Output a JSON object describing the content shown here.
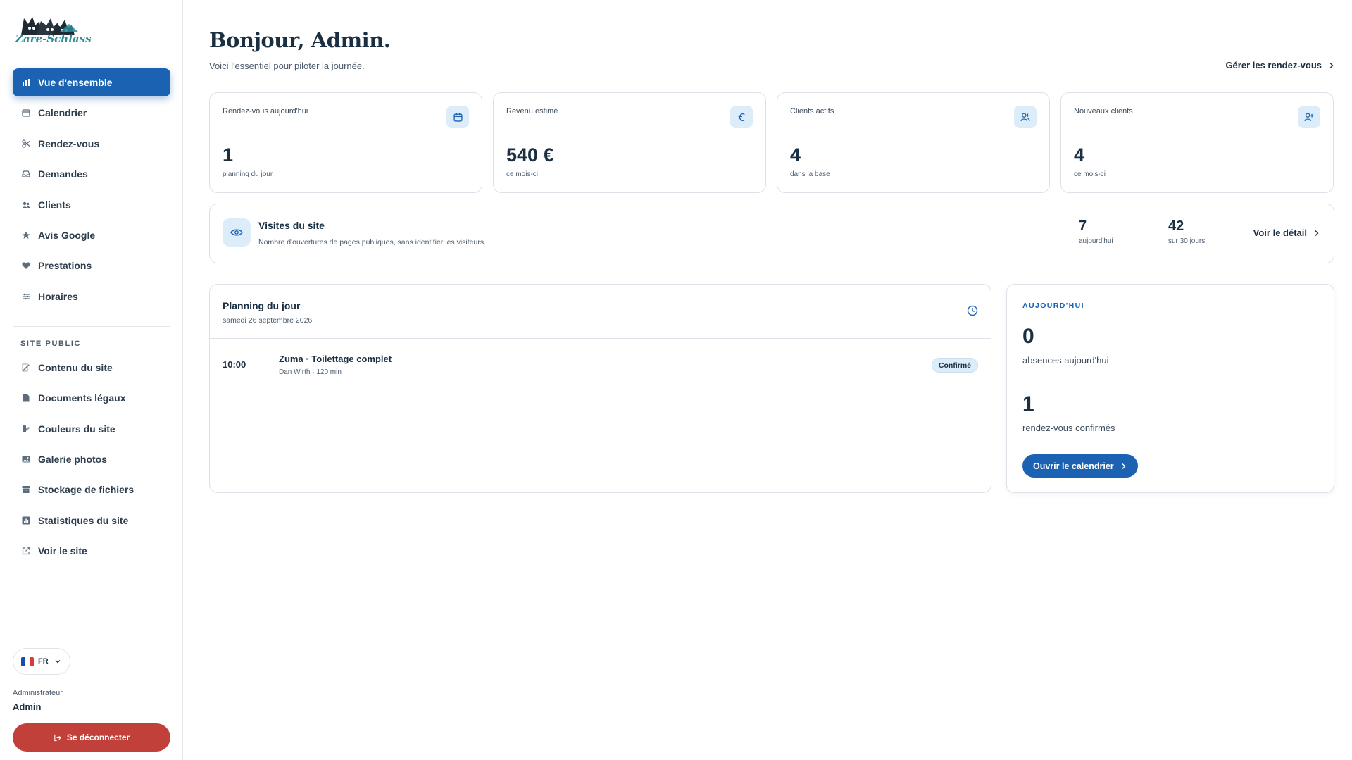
{
  "brand": {
    "logo_text": "Zare-Schlass"
  },
  "sidebar": {
    "items": [
      {
        "label": "Vue d'ensemble",
        "icon": "bar-chart-icon",
        "active": true
      },
      {
        "label": "Calendrier",
        "icon": "calendar-icon"
      },
      {
        "label": "Rendez-vous",
        "icon": "scissors-icon"
      },
      {
        "label": "Demandes",
        "icon": "inbox-icon"
      },
      {
        "label": "Clients",
        "icon": "users-icon"
      },
      {
        "label": "Avis Google",
        "icon": "star-icon"
      },
      {
        "label": "Prestations",
        "icon": "heart-icon"
      },
      {
        "label": "Horaires",
        "icon": "sliders-icon"
      }
    ],
    "section_label": "SITE PUBLIC",
    "site_items": [
      {
        "label": "Contenu du site",
        "icon": "edit-icon"
      },
      {
        "label": "Documents légaux",
        "icon": "document-icon"
      },
      {
        "label": "Couleurs du site",
        "icon": "palette-icon"
      },
      {
        "label": "Galerie photos",
        "icon": "image-icon"
      },
      {
        "label": "Stockage de fichiers",
        "icon": "archive-icon"
      },
      {
        "label": "Statistiques du site",
        "icon": "stats-icon"
      }
    ],
    "view_site": {
      "label": "Voir le site",
      "icon": "external-link-icon"
    },
    "language": "FR",
    "role": "Administrateur",
    "user": "Admin",
    "logout_label": "Se déconnecter"
  },
  "header": {
    "greeting": "Bonjour, Admin.",
    "subtitle": "Voici l'essentiel pour piloter la journée.",
    "manage_link": "Gérer les rendez-vous"
  },
  "stats": [
    {
      "label": "Rendez-vous aujourd'hui",
      "value": "1",
      "caption": "planning du jour",
      "icon": "calendar-icon"
    },
    {
      "label": "Revenu estimé",
      "value": "540 €",
      "caption": "ce mois-ci",
      "icon": "euro-icon"
    },
    {
      "label": "Clients actifs",
      "value": "4",
      "caption": "dans la base",
      "icon": "users-icon"
    },
    {
      "label": "Nouveaux clients",
      "value": "4",
      "caption": "ce mois-ci",
      "icon": "user-plus-icon"
    }
  ],
  "visits": {
    "title": "Visites du site",
    "description": "Nombre d'ouvertures de pages publiques, sans identifier les visiteurs.",
    "today_value": "7",
    "today_caption": "aujourd'hui",
    "month_value": "42",
    "month_caption": "sur 30 jours",
    "link": "Voir le détail"
  },
  "planning": {
    "title": "Planning du jour",
    "date": "samedi 26 septembre 2026",
    "appointments": [
      {
        "time": "10:00",
        "title": "Zuma · Toilettage complet",
        "meta": "Dan Wirth · 120 min",
        "status": "Confirmé"
      }
    ]
  },
  "today": {
    "label": "AUJOURD'HUI",
    "absences_value": "0",
    "absences_caption": "absences aujourd'hui",
    "confirmed_value": "1",
    "confirmed_caption": "rendez-vous confirmés",
    "button": "Ouvrir le calendrier"
  },
  "colors": {
    "primary": "#1b62b3",
    "danger": "#c2403a",
    "icon_bg": "#dcecf8",
    "text": "#1b2f42"
  }
}
